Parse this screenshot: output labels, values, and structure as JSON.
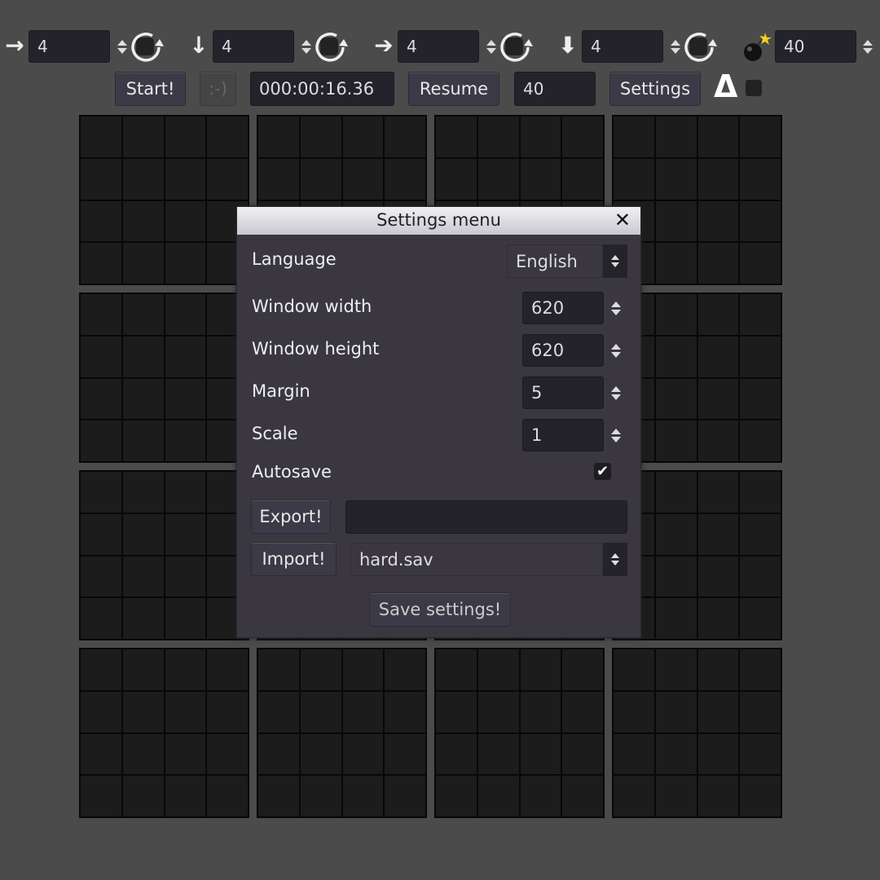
{
  "toolbar": {
    "groups": [
      {
        "icon": "arrow-right-thin-icon",
        "glyph": "→",
        "value": "4"
      },
      {
        "icon": "arrow-down-thin-icon",
        "glyph": "↓",
        "value": "4"
      },
      {
        "icon": "arrow-right-bold-icon",
        "glyph": "➔",
        "value": "4"
      },
      {
        "icon": "arrow-down-bold-icon",
        "glyph": "⬇",
        "value": "4"
      }
    ],
    "mines_value": "40",
    "start_label": "Start!",
    "smiley_label": ":-)",
    "timer": "000:00:16.36",
    "resume_label": "Resume",
    "count_value": "40",
    "settings_label": "Settings",
    "delta_glyph": "Δ"
  },
  "dialog": {
    "title": "Settings menu",
    "close_glyph": "✕",
    "language_label": "Language",
    "language_value": "English",
    "width_label": "Window width",
    "width_value": "620",
    "height_label": "Window height",
    "height_value": "620",
    "margin_label": "Margin",
    "margin_value": "5",
    "scale_label": "Scale",
    "scale_value": "1",
    "autosave_label": "Autosave",
    "autosave_checked": true,
    "check_glyph": "✔",
    "export_label": "Export!",
    "export_value": "",
    "import_label": "Import!",
    "import_value": "hard.sav",
    "save_label": "Save settings!"
  },
  "board": {
    "blocks_per_side": 4,
    "cells_per_block": 4
  }
}
